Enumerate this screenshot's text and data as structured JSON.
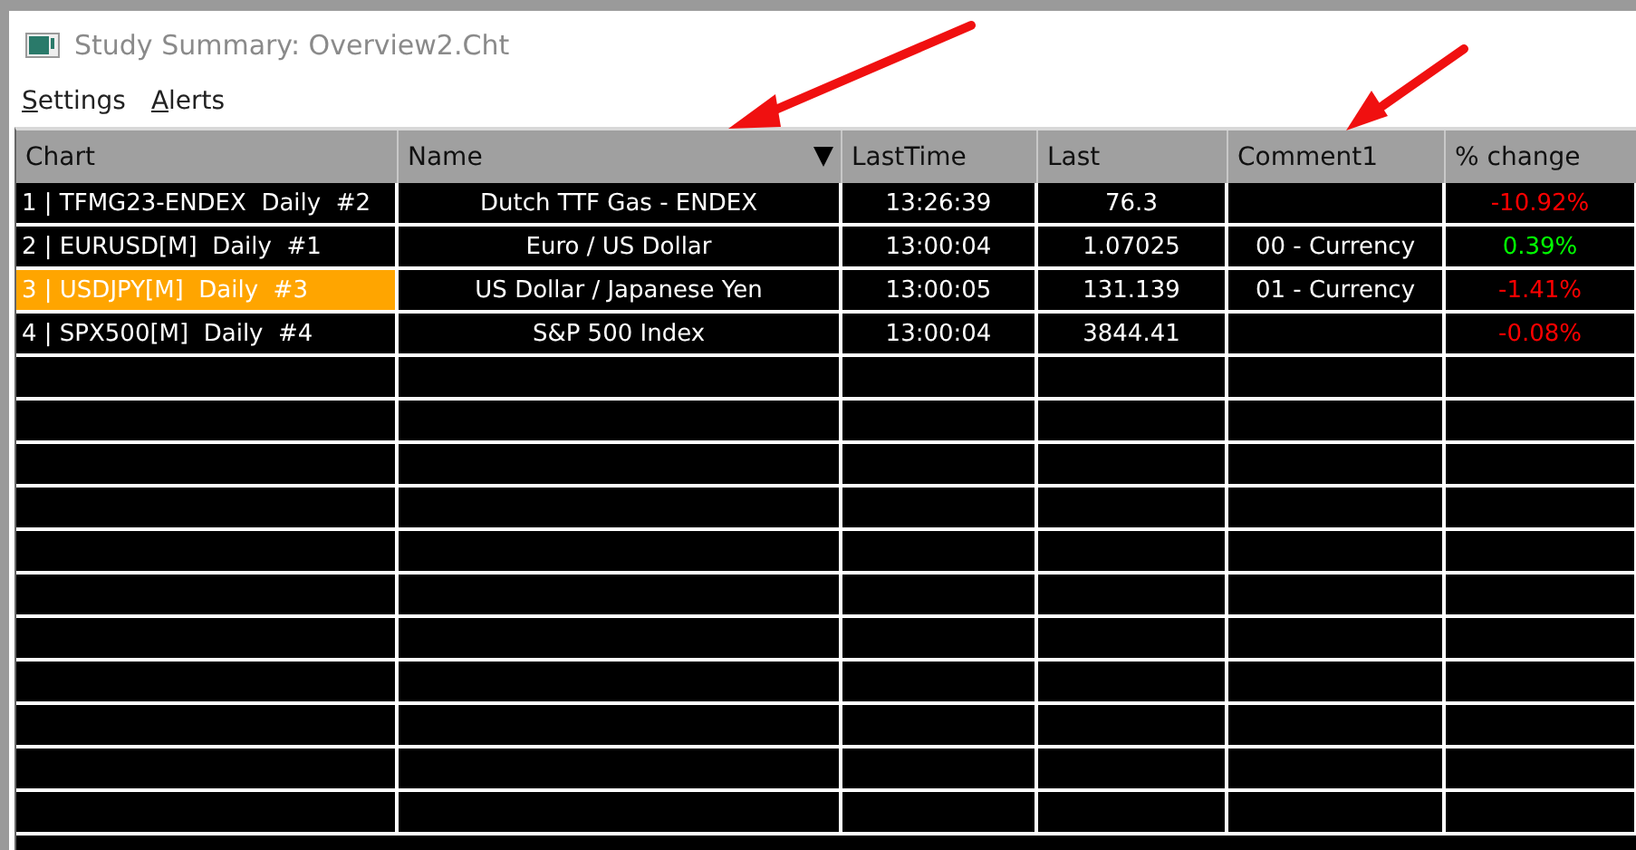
{
  "window": {
    "title": "Study Summary: Overview2.Cht"
  },
  "menu": [
    {
      "label": "Settings"
    },
    {
      "label": "Alerts"
    }
  ],
  "table": {
    "columns": [
      {
        "label": "Chart",
        "sorted": false
      },
      {
        "label": "Name",
        "sorted": true
      },
      {
        "label": "LastTime",
        "sorted": false
      },
      {
        "label": "Last",
        "sorted": false
      },
      {
        "label": "Comment1",
        "sorted": false
      },
      {
        "label": "% change",
        "sorted": false
      }
    ],
    "rows": [
      {
        "chart": "1 | TFMG23-ENDEX  Daily  #2",
        "name": "Dutch TTF Gas - ENDEX",
        "last_time": "13:26:39",
        "last": "76.3",
        "comment1": "",
        "change": "-10.92%",
        "color": "#ff0000",
        "selected": false
      },
      {
        "chart": "2 | EURUSD[M]  Daily  #1",
        "name": "Euro / US Dollar",
        "last_time": "13:00:04",
        "last": "1.07025",
        "comment1": "00 - Currency",
        "change": "0.39%",
        "color": "#00ff00",
        "selected": false
      },
      {
        "chart": "3 | USDJPY[M]  Daily  #3",
        "name": "US Dollar / Japanese Yen",
        "last_time": "13:00:05",
        "last": "131.139",
        "comment1": "01 - Currency",
        "change": "-1.41%",
        "color": "#ff0000",
        "selected": true
      },
      {
        "chart": "4 | SPX500[M]  Daily  #4",
        "name": "S&P 500 Index",
        "last_time": "13:00:04",
        "last": "3844.41",
        "comment1": "",
        "change": "-0.08%",
        "color": "#ff0000",
        "selected": false
      }
    ]
  }
}
